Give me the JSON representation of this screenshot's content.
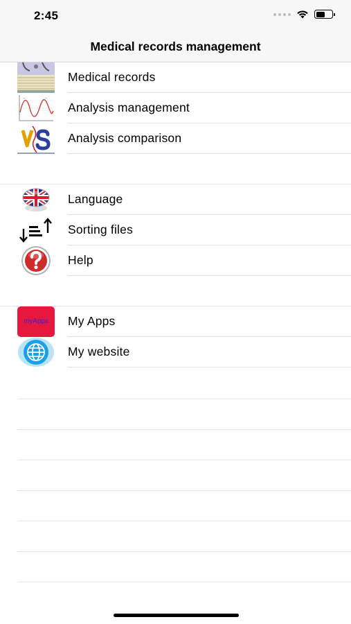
{
  "status_bar": {
    "time": "2:45",
    "icons": [
      "cellular-signal-icon",
      "wifi-icon",
      "battery-icon"
    ]
  },
  "nav": {
    "title": "Medical records management"
  },
  "sections": [
    {
      "items": [
        {
          "label": "Medical records",
          "icon": "medical-records-icon"
        },
        {
          "label": "Analysis management",
          "icon": "analysis-chart-icon"
        },
        {
          "label": "Analysis comparison",
          "icon": "versus-icon"
        }
      ]
    },
    {
      "items": [
        {
          "label": "Language",
          "icon": "uk-flag-icon"
        },
        {
          "label": "Sorting files",
          "icon": "sort-icon"
        },
        {
          "label": "Help",
          "icon": "help-icon"
        }
      ]
    },
    {
      "items": [
        {
          "label": "My Apps",
          "icon": "myapps-icon",
          "icon_text": "myApps"
        },
        {
          "label": "My website",
          "icon": "globe-icon"
        }
      ]
    }
  ],
  "colors": {
    "myapps_bg": "#e8173d",
    "myapps_text": "#3a1fd6",
    "help_red": "#d42a2a",
    "globe_blue": "#1aa0e8"
  }
}
